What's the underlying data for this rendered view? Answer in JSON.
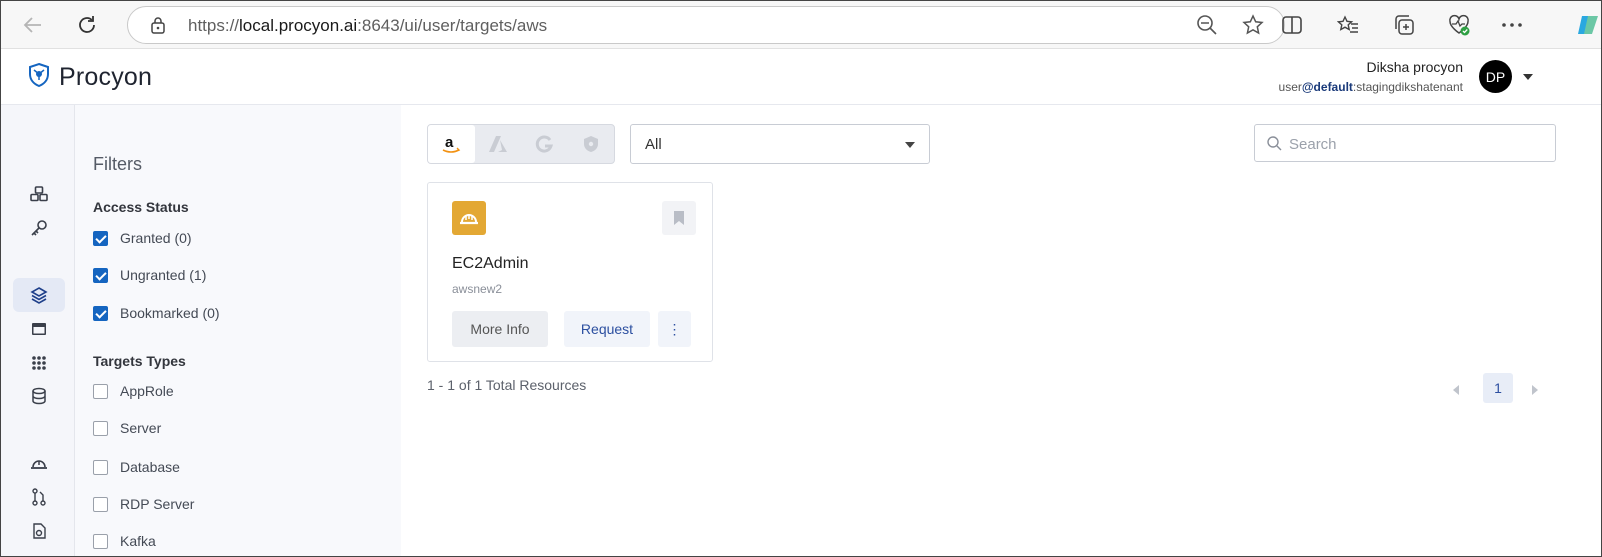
{
  "browser": {
    "url_prefix": "https://",
    "url_host": "local.procyon.ai",
    "url_rest": ":8643/ui/user/targets/aws"
  },
  "app": {
    "name": "Procyon",
    "brand_color": "#1565c0"
  },
  "user": {
    "name": "Diksha procyon",
    "tenant_prefix": "user",
    "tenant_bold": "@default",
    "tenant_suffix": ":stagingdikshatenant",
    "initials": "DP"
  },
  "filters": {
    "title": "Filters",
    "access_status": {
      "title": "Access Status",
      "items": [
        {
          "label": "Granted (0)",
          "checked": true
        },
        {
          "label": "Ungranted (1)",
          "checked": true
        },
        {
          "label": "Bookmarked (0)",
          "checked": true
        }
      ]
    },
    "target_types": {
      "title": "Targets Types",
      "items": [
        {
          "label": "AppRole",
          "checked": false
        },
        {
          "label": "Server",
          "checked": false
        },
        {
          "label": "Database",
          "checked": false
        },
        {
          "label": "RDP Server",
          "checked": false
        },
        {
          "label": "Kafka",
          "checked": false
        }
      ]
    }
  },
  "toolbar": {
    "provider_tabs": [
      {
        "glyph": "a",
        "name": "aws",
        "active": true
      },
      {
        "glyph": "A",
        "name": "azure",
        "active": false
      },
      {
        "glyph": "G",
        "name": "gcp",
        "active": false
      },
      {
        "glyph": "shield",
        "name": "other",
        "active": false
      }
    ],
    "account_select": "All",
    "search_placeholder": "Search"
  },
  "resources": [
    {
      "name": "EC2Admin",
      "account": "awsnew2",
      "icon": "hardhat-icon",
      "icon_color": "#e3a834",
      "more_label": "More Info",
      "request_label": "Request",
      "kebab": "⋮"
    }
  ],
  "pagination": {
    "summary": "1 - 1 of 1 Total Resources",
    "current_page": "1"
  }
}
